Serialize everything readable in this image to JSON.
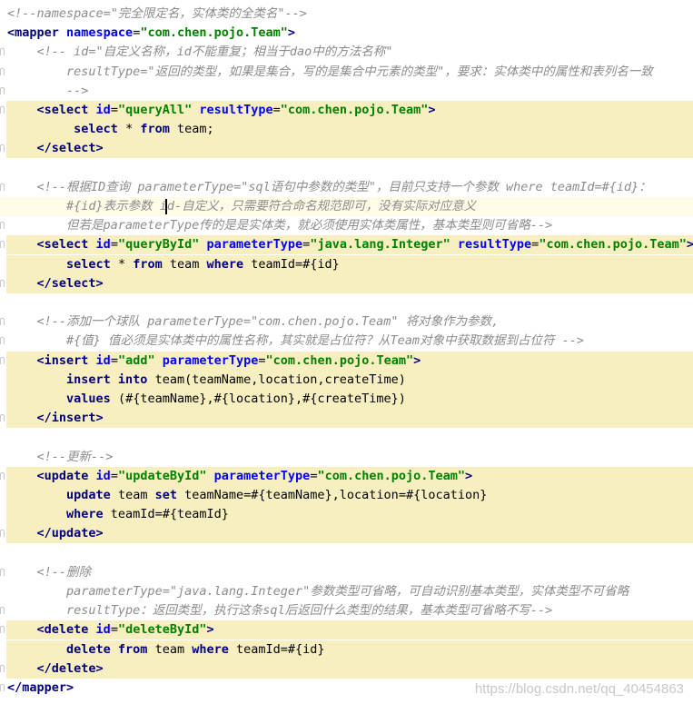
{
  "lines": [
    {
      "hl": false,
      "segs": [
        {
          "c": "cm",
          "t": "<!--namespace=\"完全限定名，实体类的全类名\"-->"
        }
      ]
    },
    {
      "hl": false,
      "segs": [
        {
          "c": "tg",
          "t": "<mapper "
        },
        {
          "c": "an",
          "t": "namespace"
        },
        {
          "c": "pl",
          "t": "="
        },
        {
          "c": "av",
          "t": "\"com.chen.pojo.Team\""
        },
        {
          "c": "tg",
          "t": ">"
        }
      ]
    },
    {
      "hl": false,
      "gutter": true,
      "segs": [
        {
          "c": "pl",
          "t": "    "
        },
        {
          "c": "cm",
          "t": "<!-- id=\"自定义名称，id不能重复；相当于dao中的方法名称\""
        }
      ]
    },
    {
      "hl": false,
      "gutter": true,
      "segs": [
        {
          "c": "pl",
          "t": "        "
        },
        {
          "c": "cm",
          "t": "resultType=\"返回的类型，如果是集合，写的是集合中元素的类型\"，要求：实体类中的属性和表列名一致"
        }
      ]
    },
    {
      "hl": false,
      "gutter": true,
      "segs": [
        {
          "c": "pl",
          "t": "        "
        },
        {
          "c": "cm",
          "t": "-->"
        }
      ]
    },
    {
      "hl": true,
      "gutter": true,
      "segs": [
        {
          "c": "pl",
          "t": "    "
        },
        {
          "c": "tg",
          "t": "<select "
        },
        {
          "c": "an",
          "t": "id"
        },
        {
          "c": "pl",
          "t": "="
        },
        {
          "c": "av",
          "t": "\"queryAll\""
        },
        {
          "c": "pl",
          "t": " "
        },
        {
          "c": "an",
          "t": "resultType"
        },
        {
          "c": "pl",
          "t": "="
        },
        {
          "c": "av",
          "t": "\"com.chen.pojo.Team\""
        },
        {
          "c": "tg",
          "t": ">"
        }
      ]
    },
    {
      "hl": true,
      "segs": [
        {
          "c": "pl",
          "t": "         "
        },
        {
          "c": "kw",
          "t": "select"
        },
        {
          "c": "pl",
          "t": " * "
        },
        {
          "c": "kw",
          "t": "from"
        },
        {
          "c": "pl",
          "t": " team;"
        }
      ]
    },
    {
      "hl": true,
      "gutter": true,
      "segs": [
        {
          "c": "pl",
          "t": "    "
        },
        {
          "c": "tg",
          "t": "</select>"
        }
      ]
    },
    {
      "hl": false,
      "segs": []
    },
    {
      "hl": false,
      "gutter": true,
      "segs": [
        {
          "c": "pl",
          "t": "    "
        },
        {
          "c": "cm",
          "t": "<!--根据ID查询 parameterType=\"sql语句中参数的类型\"，目前只支持一个参数 where teamId=#{id}："
        }
      ]
    },
    {
      "hl": false,
      "cur": true,
      "caret": true,
      "segs": [
        {
          "c": "pl",
          "t": "        "
        },
        {
          "c": "cm",
          "t": "#{id}表示参数 id-自定义，只需要符合命名规范即可，没有实际对应意义"
        }
      ]
    },
    {
      "hl": false,
      "gutter": true,
      "segs": [
        {
          "c": "pl",
          "t": "        "
        },
        {
          "c": "cm",
          "t": "但若是parameterType传的是是实体类，就必须使用实体类属性，基本类型则可省略-->"
        }
      ]
    },
    {
      "hl": true,
      "gutter": true,
      "segs": [
        {
          "c": "pl",
          "t": "    "
        },
        {
          "c": "tg",
          "t": "<select "
        },
        {
          "c": "an",
          "t": "id"
        },
        {
          "c": "pl",
          "t": "="
        },
        {
          "c": "av",
          "t": "\"queryById\""
        },
        {
          "c": "pl",
          "t": " "
        },
        {
          "c": "an",
          "t": "parameterType"
        },
        {
          "c": "pl",
          "t": "="
        },
        {
          "c": "av",
          "t": "\"java.lang.Integer\""
        },
        {
          "c": "pl",
          "t": " "
        },
        {
          "c": "an",
          "t": "resultType"
        },
        {
          "c": "pl",
          "t": "="
        },
        {
          "c": "av",
          "t": "\"com.chen.pojo.Team\""
        },
        {
          "c": "tg",
          "t": ">"
        }
      ]
    },
    {
      "hl": true,
      "segs": [
        {
          "c": "pl",
          "t": "        "
        },
        {
          "c": "kw",
          "t": "select"
        },
        {
          "c": "pl",
          "t": " * "
        },
        {
          "c": "kw",
          "t": "from"
        },
        {
          "c": "pl",
          "t": " team "
        },
        {
          "c": "kw",
          "t": "where"
        },
        {
          "c": "pl",
          "t": " teamId=#{id}"
        }
      ]
    },
    {
      "hl": true,
      "gutter": true,
      "segs": [
        {
          "c": "pl",
          "t": "    "
        },
        {
          "c": "tg",
          "t": "</select>"
        }
      ]
    },
    {
      "hl": false,
      "segs": []
    },
    {
      "hl": false,
      "gutter": true,
      "segs": [
        {
          "c": "pl",
          "t": "    "
        },
        {
          "c": "cm",
          "t": "<!--添加一个球队 parameterType=\"com.chen.pojo.Team\" 将对象作为参数,"
        }
      ]
    },
    {
      "hl": false,
      "gutter": true,
      "segs": [
        {
          "c": "pl",
          "t": "        "
        },
        {
          "c": "cm",
          "t": "#{值} 值必须是实体类中的属性名称，其实就是占位符？从Team对象中获取数据到占位符 -->"
        }
      ]
    },
    {
      "hl": true,
      "gutter": true,
      "segs": [
        {
          "c": "pl",
          "t": "    "
        },
        {
          "c": "tg",
          "t": "<insert "
        },
        {
          "c": "an",
          "t": "id"
        },
        {
          "c": "pl",
          "t": "="
        },
        {
          "c": "av",
          "t": "\"add\""
        },
        {
          "c": "pl",
          "t": " "
        },
        {
          "c": "an",
          "t": "parameterType"
        },
        {
          "c": "pl",
          "t": "="
        },
        {
          "c": "av",
          "t": "\"com.chen.pojo.Team\""
        },
        {
          "c": "tg",
          "t": ">"
        }
      ]
    },
    {
      "hl": true,
      "segs": [
        {
          "c": "pl",
          "t": "        "
        },
        {
          "c": "kw",
          "t": "insert into"
        },
        {
          "c": "pl",
          "t": " team(teamName,location,createTime)"
        }
      ]
    },
    {
      "hl": true,
      "segs": [
        {
          "c": "pl",
          "t": "        "
        },
        {
          "c": "kw",
          "t": "values"
        },
        {
          "c": "pl",
          "t": " (#{teamName},#{location},#{createTime})"
        }
      ]
    },
    {
      "hl": true,
      "gutter": true,
      "segs": [
        {
          "c": "pl",
          "t": "    "
        },
        {
          "c": "tg",
          "t": "</insert>"
        }
      ]
    },
    {
      "hl": false,
      "segs": []
    },
    {
      "hl": false,
      "segs": [
        {
          "c": "pl",
          "t": "    "
        },
        {
          "c": "cm",
          "t": "<!--更新-->"
        }
      ]
    },
    {
      "hl": true,
      "gutter": true,
      "segs": [
        {
          "c": "pl",
          "t": "    "
        },
        {
          "c": "tg",
          "t": "<update "
        },
        {
          "c": "an",
          "t": "id"
        },
        {
          "c": "pl",
          "t": "="
        },
        {
          "c": "av",
          "t": "\"updateById\""
        },
        {
          "c": "pl",
          "t": " "
        },
        {
          "c": "an",
          "t": "parameterType"
        },
        {
          "c": "pl",
          "t": "="
        },
        {
          "c": "av",
          "t": "\"com.chen.pojo.Team\""
        },
        {
          "c": "tg",
          "t": ">"
        }
      ]
    },
    {
      "hl": true,
      "segs": [
        {
          "c": "pl",
          "t": "        "
        },
        {
          "c": "kw",
          "t": "update"
        },
        {
          "c": "pl",
          "t": " team "
        },
        {
          "c": "kw",
          "t": "set"
        },
        {
          "c": "pl",
          "t": " teamName=#{teamName},location=#{location}"
        }
      ]
    },
    {
      "hl": true,
      "segs": [
        {
          "c": "pl",
          "t": "        "
        },
        {
          "c": "kw",
          "t": "where"
        },
        {
          "c": "pl",
          "t": " teamId=#{teamId}"
        }
      ]
    },
    {
      "hl": true,
      "gutter": true,
      "segs": [
        {
          "c": "pl",
          "t": "    "
        },
        {
          "c": "tg",
          "t": "</update>"
        }
      ]
    },
    {
      "hl": false,
      "segs": []
    },
    {
      "hl": false,
      "gutter": true,
      "segs": [
        {
          "c": "pl",
          "t": "    "
        },
        {
          "c": "cm",
          "t": "<!--删除"
        }
      ]
    },
    {
      "hl": false,
      "segs": [
        {
          "c": "pl",
          "t": "        "
        },
        {
          "c": "cm",
          "t": "parameterType=\"java.lang.Integer\"参数类型可省略，可自动识别基本类型，实体类型不可省略"
        }
      ]
    },
    {
      "hl": false,
      "gutter": true,
      "segs": [
        {
          "c": "pl",
          "t": "        "
        },
        {
          "c": "cm",
          "t": "resultType：返回类型，执行这条sql后返回什么类型的结果，基本类型可省略不写-->"
        }
      ]
    },
    {
      "hl": true,
      "gutter": true,
      "segs": [
        {
          "c": "pl",
          "t": "    "
        },
        {
          "c": "tg",
          "t": "<delete "
        },
        {
          "c": "an",
          "t": "id"
        },
        {
          "c": "pl",
          "t": "="
        },
        {
          "c": "av",
          "t": "\"deleteById\""
        },
        {
          "c": "tg",
          "t": ">"
        }
      ]
    },
    {
      "hl": true,
      "segs": [
        {
          "c": "pl",
          "t": "        "
        },
        {
          "c": "kw",
          "t": "delete from"
        },
        {
          "c": "pl",
          "t": " team "
        },
        {
          "c": "kw",
          "t": "where"
        },
        {
          "c": "pl",
          "t": " teamId=#{id}"
        }
      ]
    },
    {
      "hl": true,
      "gutter": true,
      "segs": [
        {
          "c": "pl",
          "t": "    "
        },
        {
          "c": "tg",
          "t": "</delete>"
        }
      ]
    },
    {
      "hl": false,
      "gutter": true,
      "segs": [
        {
          "c": "tg",
          "t": "</mapper>"
        }
      ]
    }
  ],
  "watermark": "https://blog.csdn.net/qq_40454863"
}
